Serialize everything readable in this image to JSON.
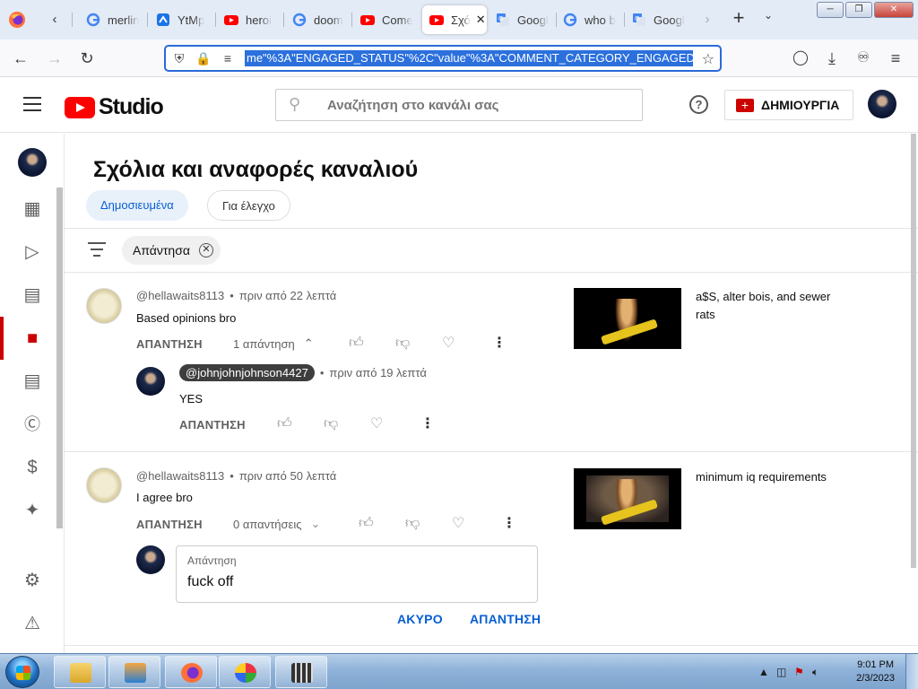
{
  "browser": {
    "tabs": [
      {
        "label": "merlin",
        "icon": "google-icon"
      },
      {
        "label": "YtMp",
        "icon": "ytmp-icon"
      },
      {
        "label": "heroi",
        "icon": "youtube-icon"
      },
      {
        "label": "doom",
        "icon": "google-icon"
      },
      {
        "label": "Come",
        "icon": "youtube-icon"
      },
      {
        "label": "Σχό",
        "icon": "youtube-icon",
        "active": true
      },
      {
        "label": "Googl",
        "icon": "google-translate-icon"
      },
      {
        "label": "who b",
        "icon": "google-icon"
      },
      {
        "label": "Googl",
        "icon": "google-translate-icon"
      }
    ],
    "url": "me\"%3A\"ENGAGED_STATUS\"%2C\"value\"%3A\"COMMENT_CATEGORY_ENGAGED\"}]",
    "accent": "#2b70dd"
  },
  "header": {
    "logo_text": "Studio",
    "search_placeholder": "Αναζήτηση στο κανάλι σας",
    "create_label": "ΔΗΜΙΟΥΡΓΙΑ",
    "help_glyph": "?",
    "brand_color": "#ff0000"
  },
  "sidebar": {
    "items": [
      {
        "name": "dashboard",
        "icon": "dashboard-icon"
      },
      {
        "name": "content",
        "icon": "content-icon"
      },
      {
        "name": "analytics",
        "icon": "analytics-icon"
      },
      {
        "name": "comments",
        "icon": "comments-icon",
        "active": true
      },
      {
        "name": "subtitles",
        "icon": "subtitles-icon"
      },
      {
        "name": "copyright",
        "icon": "copyright-icon"
      },
      {
        "name": "earn",
        "icon": "earn-icon"
      },
      {
        "name": "customization",
        "icon": "customization-icon"
      },
      {
        "name": "settings",
        "icon": "settings-icon"
      },
      {
        "name": "feedback",
        "icon": "feedback-icon"
      }
    ]
  },
  "page": {
    "title": "Σχόλια και αναφορές καναλιού",
    "tabs": [
      {
        "label": "Δημοσιευμένα",
        "active": true
      },
      {
        "label": "Για έλεγχο",
        "active": false
      }
    ],
    "filter_chip": "Απάντησα"
  },
  "comments": [
    {
      "author": "@hellawaits8113",
      "time": "πριν από 22 λεπτά",
      "text": "Based opinions bro",
      "reply_label": "ΑΠΑΝΤΗΣΗ",
      "replies_label": "1 απάντηση",
      "video_title": "a$S, alter bois, and sewer rats",
      "reply": {
        "author": "@johnjohnjohnson4427",
        "time": "πριν από 19 λεπτά",
        "text": "YES",
        "reply_label": "ΑΠΑΝΤΗΣΗ"
      }
    },
    {
      "author": "@hellawaits8113",
      "time": "πριν από 50 λεπτά",
      "text": "I agree bro",
      "reply_label": "ΑΠΑΝΤΗΣΗ",
      "replies_label": "0 απαντήσεις",
      "video_title": "minimum iq requirements",
      "reply_box": {
        "label": "Απάντηση",
        "value": "fuck off",
        "cancel_label": "ΑΚΥΡΟ",
        "submit_label": "ΑΠΑΝΤΗΣΗ"
      }
    }
  ],
  "taskbar": {
    "apps": [
      "explorer-icon",
      "media-player-icon",
      "firefox-icon",
      "paint-icon",
      "movie-maker-icon"
    ],
    "time": "9:01 PM",
    "date": "2/3/2023"
  }
}
